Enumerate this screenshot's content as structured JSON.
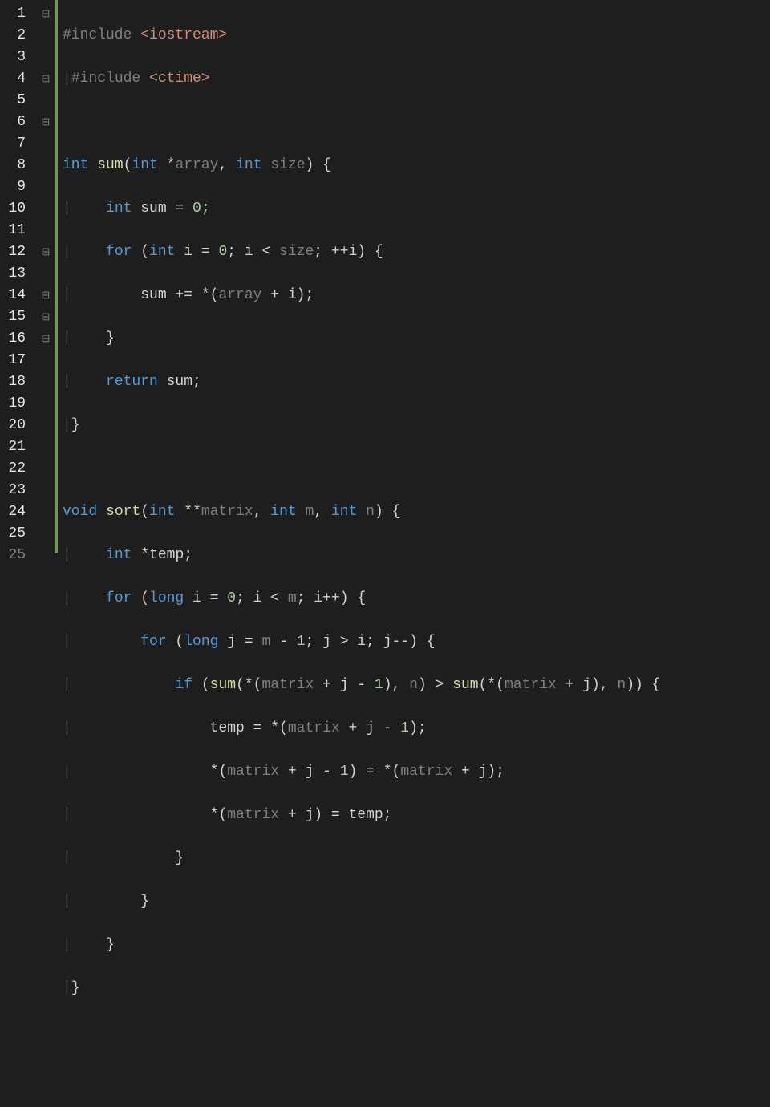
{
  "colors": {
    "background": "#1e1e1e",
    "keyword": "#569cd6",
    "function": "#dcdcaa",
    "number": "#b5cea8",
    "string": "#ce9178",
    "default": "#d4d4d4",
    "dim": "#808080",
    "gutter": "#858585",
    "changebar": "#6a9955"
  },
  "line_numbers": [
    "1",
    "2",
    "3",
    "4",
    "5",
    "6",
    "7",
    "8",
    "9",
    "10",
    "11",
    "12",
    "13",
    "14",
    "15",
    "16",
    "17",
    "18",
    "19",
    "20",
    "21",
    "22",
    "23",
    "24",
    "25"
  ],
  "fold_markers": {
    "1": "⊟",
    "4": "⊟",
    "6": "⊟",
    "12": "⊟",
    "14": "⊟",
    "15": "⊟",
    "16": "⊟"
  },
  "code": {
    "l1": {
      "pre": "#include ",
      "inc": "<iostream>"
    },
    "l2": {
      "pipe": "|",
      "pre": "#include ",
      "inc": "<ctime>"
    },
    "l3": {
      "text": ""
    },
    "l4": {
      "kw1": "int",
      "fn": " sum",
      "p1": "(",
      "kw2": "int ",
      "op1": "*",
      "par1": "array",
      "comma": ", ",
      "kw3": "int ",
      "par2": "size",
      "p2": ") {"
    },
    "l5": {
      "pipe": "|    ",
      "kw": "int",
      "rest": " sum = ",
      "num": "0",
      "semi": ";"
    },
    "l6": {
      "pipe": "|    ",
      "kw": "for",
      "p1": " (",
      "kw2": "int",
      "rest1": " i = ",
      "num": "0",
      "rest2": "; i < ",
      "par": "size",
      "rest3": "; ++i) {"
    },
    "l7": {
      "pipe": "|        ",
      "text": "sum += *(",
      "par": "array",
      "rest": " + i);"
    },
    "l8": {
      "pipe": "|    ",
      "text": "}"
    },
    "l9": {
      "pipe": "|    ",
      "kw": "return",
      "rest": " sum;"
    },
    "l10": {
      "pipe": "|",
      "text": "}"
    },
    "l11": {
      "text": ""
    },
    "l12": {
      "kw1": "void",
      "fn": " sort",
      "p1": "(",
      "kw2": "int ",
      "op1": "**",
      "par1": "matrix",
      "c1": ", ",
      "kw3": "int ",
      "par2": "m",
      "c2": ", ",
      "kw4": "int ",
      "par3": "n",
      "p2": ") {"
    },
    "l13": {
      "pipe": "|    ",
      "kw": "int ",
      "op": "*",
      "id": "temp;"
    },
    "l14": {
      "pipe": "|    ",
      "kw": "for",
      "p1": " (",
      "kw2": "long",
      "r1": " i = ",
      "num": "0",
      "r2": "; i < ",
      "par": "m",
      "r3": "; i++) {"
    },
    "l15": {
      "pipe": "|        ",
      "kw": "for",
      "p1": " (",
      "kw2": "long",
      "r1": " j = ",
      "par1": "m",
      "r2": " - ",
      "num": "1",
      "r3": "; j > i; j--) {"
    },
    "l16": {
      "pipe": "|            ",
      "kw": "if",
      "p1": " (",
      "fn1": "sum",
      "r1": "(*(",
      "par1": "matrix",
      "r2": " + j - ",
      "num1": "1",
      "r3": "), ",
      "par2": "n",
      "r4": ") > ",
      "fn2": "sum",
      "r5": "(*(",
      "par3": "matrix",
      "r6": " + j), ",
      "par4": "n",
      "r7": ")) {"
    },
    "l17": {
      "pipe": "|                ",
      "r1": "temp = *(",
      "par": "matrix",
      "r2": " + j - ",
      "num": "1",
      "r3": ");"
    },
    "l18": {
      "pipe": "|                ",
      "r1": "*(",
      "par1": "matrix",
      "r2": " + j - ",
      "num": "1",
      "r3": ") = *(",
      "par2": "matrix",
      "r4": " + j);"
    },
    "l19": {
      "pipe": "|                ",
      "r1": "*(",
      "par": "matrix",
      "r2": " + j) = temp;"
    },
    "l20": {
      "pipe": "|            ",
      "text": "}"
    },
    "l21": {
      "pipe": "|        ",
      "text": "}"
    },
    "l22": {
      "pipe": "|    ",
      "text": "}"
    },
    "l23": {
      "pipe": "|",
      "text": "}"
    },
    "l24": {
      "text": ""
    },
    "l25": {
      "text": ""
    }
  }
}
